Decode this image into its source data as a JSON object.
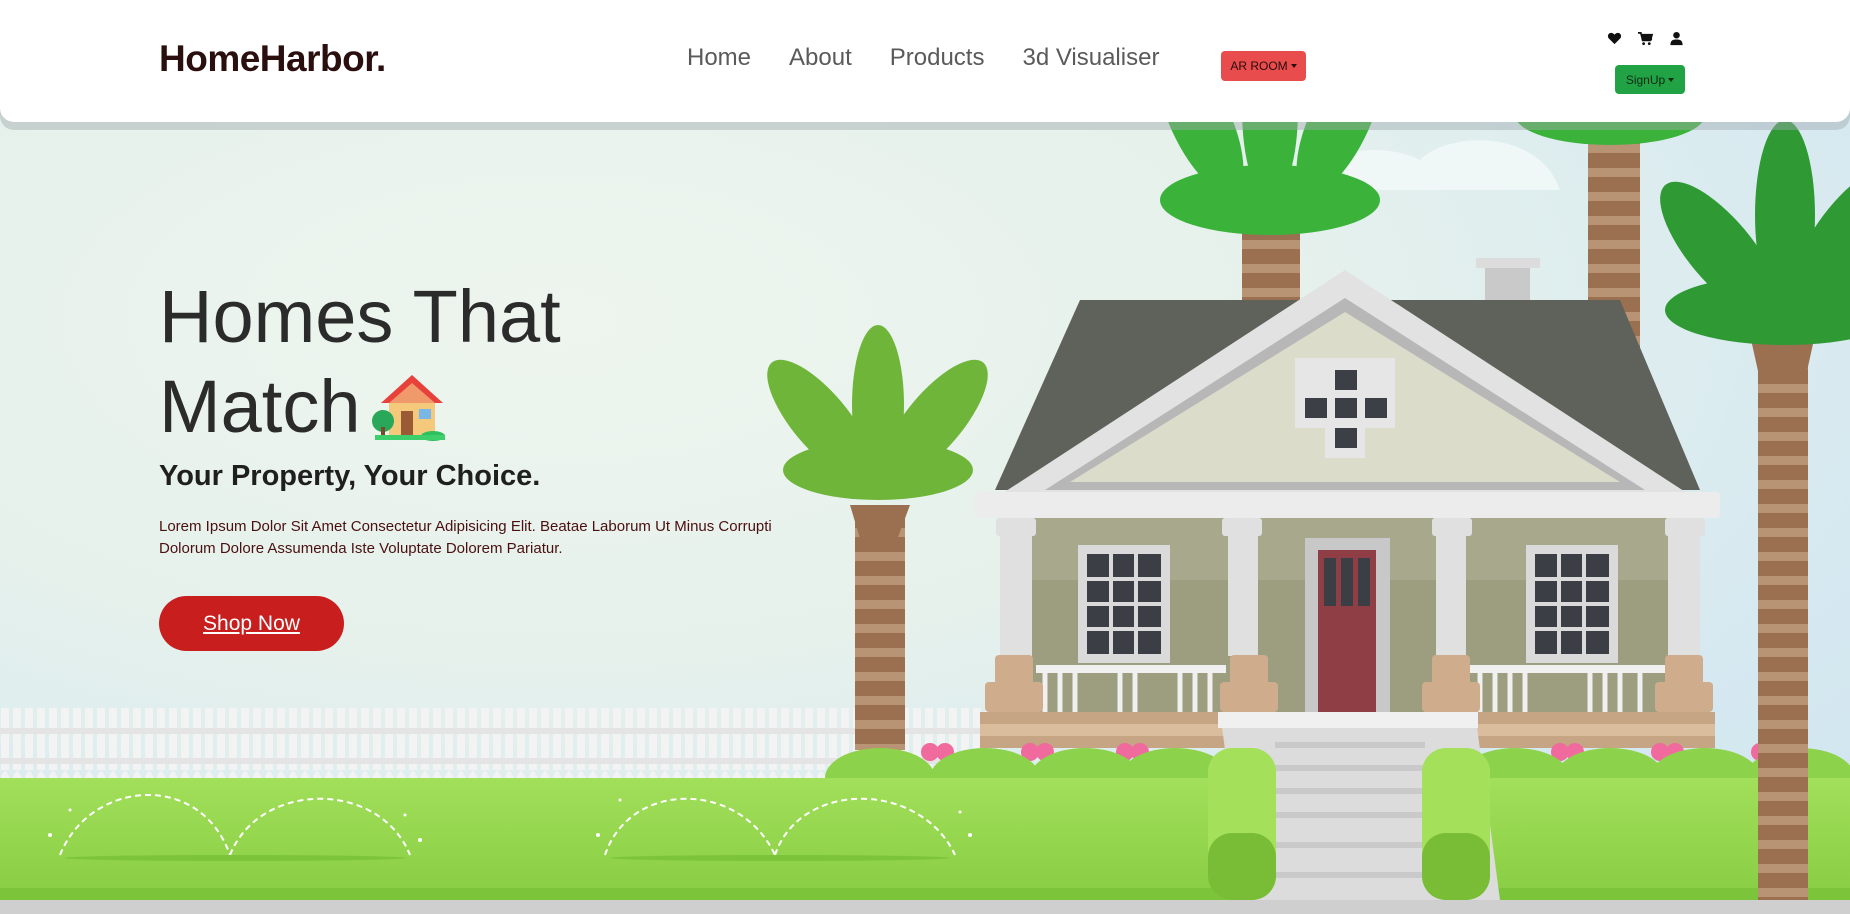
{
  "brand": {
    "name": "HomeHarbor."
  },
  "nav": {
    "links": [
      "Home",
      "About",
      "Products",
      "3d Visualiser"
    ],
    "ar_room": "AR ROOM",
    "signup": "SignUp"
  },
  "header_icons": [
    "heart-icon",
    "cart-icon",
    "user-icon"
  ],
  "hero": {
    "headline_line1": "Homes That",
    "headline_line2": "Match",
    "emoji_icon": "house-with-garden-icon",
    "subheadline": "Your Property, Your Choice.",
    "description": "Lorem Ipsum Dolor Sit Amet Consectetur Adipisicing Elit. Beatae Laborum Ut Minus Corrupti Dolorum Dolore Assumenda Iste Voluptate Dolorem Pariatur.",
    "cta": "Shop Now"
  },
  "colors": {
    "brand_text": "#2b0f0f",
    "ar_button": "#e84c4c",
    "signup_button": "#21a345",
    "cta_button": "#c81e1e",
    "grass": "#8cd24a",
    "roof": "#5f625b"
  }
}
